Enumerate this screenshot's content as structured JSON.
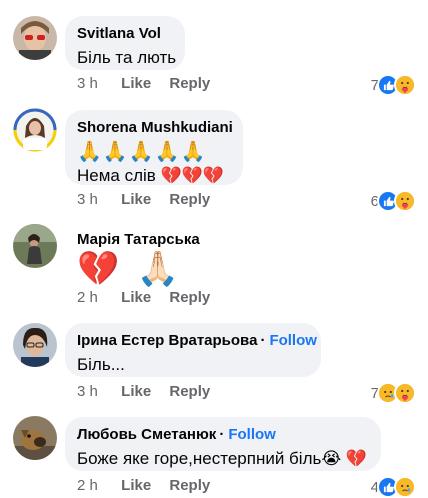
{
  "comments": [
    {
      "author": "Svitlana Vol",
      "text": "Біль та лють",
      "time": "3 h",
      "like": "Like",
      "reply": "Reply",
      "reactions_count": "7",
      "reactions": [
        "like",
        "care"
      ]
    },
    {
      "author": "Shorena Mushkudiani",
      "emoji_line": "🙏🙏🙏🙏🙏",
      "text": "Нема слів 💔💔💔",
      "time": "3 h",
      "like": "Like",
      "reply": "Reply",
      "reactions_count": "6",
      "reactions": [
        "like",
        "care"
      ]
    },
    {
      "author": "Марія Татарська",
      "emoji": "💔 🙏🏻",
      "time": "2 h",
      "like": "Like",
      "reply": "Reply"
    },
    {
      "author": "Ірина Естер Вратарьова",
      "follow": "Follow",
      "text": "Біль...",
      "time": "3 h",
      "like": "Like",
      "reply": "Reply",
      "reactions_count": "7",
      "reactions": [
        "sad",
        "care"
      ]
    },
    {
      "author": "Любовь Сметанюк",
      "follow": "Follow",
      "text": "Боже яке горе,нестерпний біль😭 💔",
      "time": "2 h",
      "like": "Like",
      "reply": "Reply",
      "reactions_count": "4",
      "reactions": [
        "like",
        "sad"
      ]
    }
  ],
  "colors": {
    "bubble": "#f0f2f5",
    "link": "#1877f2",
    "meta": "#65676b"
  },
  "separator": "·"
}
